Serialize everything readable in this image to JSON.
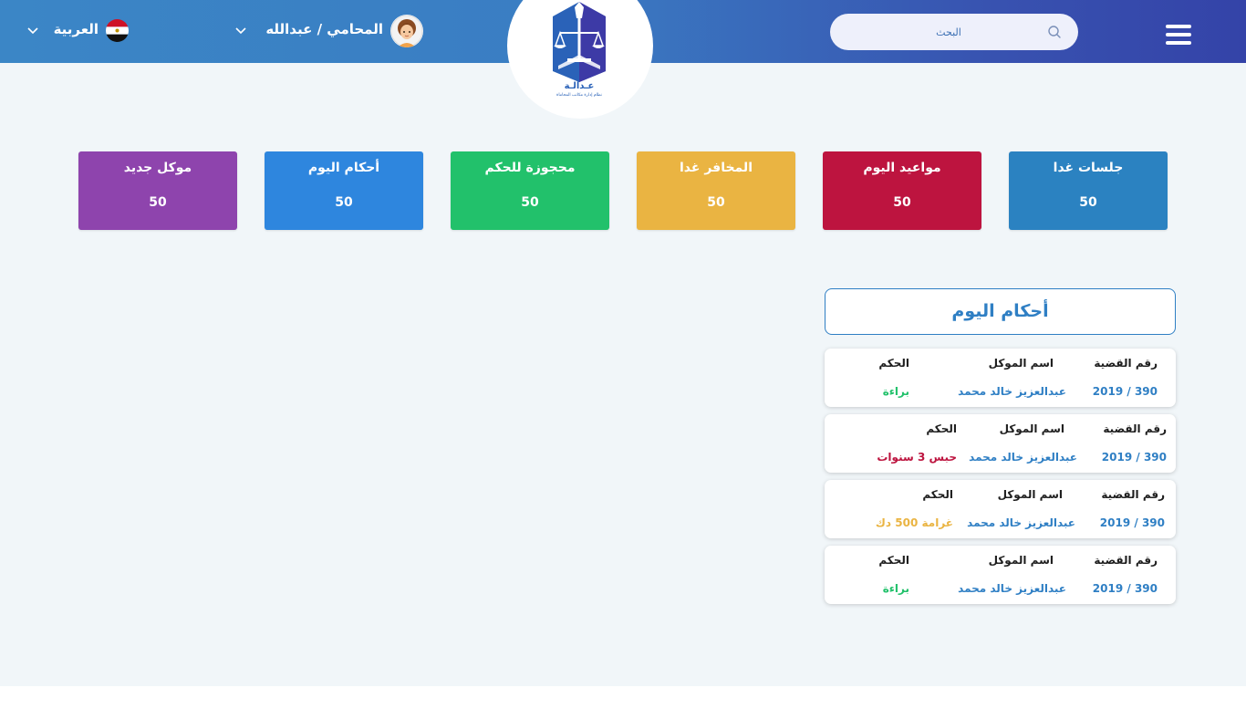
{
  "header": {
    "search_placeholder": "البحث",
    "user_name": "المحامي / عبدالله",
    "language": "العربية",
    "logo_text": "عـدالـة",
    "logo_subtitle": "نظام إدارة مكاتب المحاماة"
  },
  "stats": [
    {
      "title": "جلسات غدا",
      "value": "50",
      "color": "#2b82c1"
    },
    {
      "title": "مواعيد اليوم",
      "value": "50",
      "color": "#bd143f"
    },
    {
      "title": "المخافر غدا",
      "value": "50",
      "color": "#eab442"
    },
    {
      "title": "محجوزة للحكم",
      "value": "50",
      "color": "#22c16b"
    },
    {
      "title": "أحكام اليوم",
      "value": "50",
      "color": "#2e86de"
    },
    {
      "title": "موكل جديد",
      "value": "50",
      "color": "#8e44ad"
    }
  ],
  "judgments": {
    "title": "أحكام اليوم",
    "labels": {
      "case_no": "رقم القضية",
      "client": "اسم الموكل",
      "verdict": "الحكم"
    },
    "items": [
      {
        "case_no": "390 / 2019",
        "client": "عبدالعزيز خالد محمد",
        "verdict": "براءة",
        "verdict_color": "#22c16b"
      },
      {
        "case_no": "390 / 2019",
        "client": "عبدالعزيز خالد محمد",
        "verdict": "حبس 3 سنوات",
        "verdict_color": "#bd143f"
      },
      {
        "case_no": "390 / 2019",
        "client": "عبدالعزيز خالد محمد",
        "verdict": "غرامة 500 دك",
        "verdict_color": "#eab442"
      },
      {
        "case_no": "390 / 2019",
        "client": "عبدالعزيز خالد محمد",
        "verdict": "براءة",
        "verdict_color": "#22c16b"
      }
    ]
  }
}
